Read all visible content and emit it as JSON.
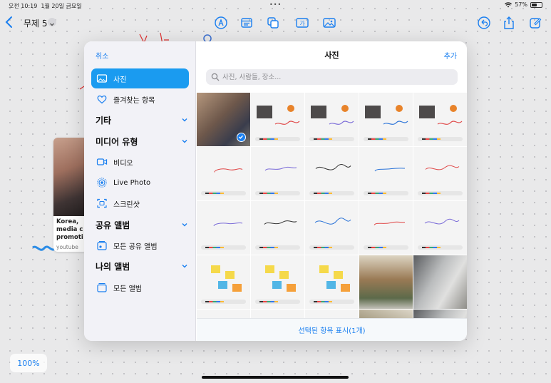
{
  "status": {
    "time": "오전 10:19",
    "date": "1월 20일 금요일",
    "battery": "57%",
    "battery_level": 0.57
  },
  "topbar": {
    "title": "무제 5",
    "tools": [
      "markup-pen-icon",
      "text-box-icon",
      "shapes-icon",
      "text-icon",
      "photo-icon",
      "undo-icon",
      "share-icon",
      "compose-icon"
    ]
  },
  "canvas": {
    "sticker": {
      "caption_lines": [
        "Korea,",
        "media c",
        "promoti"
      ],
      "source": "youtube"
    },
    "zoom": "100%"
  },
  "picker": {
    "cancel": "취소",
    "title": "사진",
    "add": "추가",
    "search_placeholder": "사진, 사람들, 장소...",
    "sidebar": {
      "photos": "사진",
      "favorites": "즐겨찾는 항목",
      "other_header": "기타",
      "media_header": "미디어 유형",
      "videos": "비디오",
      "live_photo": "Live Photo",
      "screenshots": "스크린샷",
      "shared_header": "공유 앨범",
      "all_shared": "모든 공유 앨범",
      "my_albums_header": "나의 앨범",
      "all_albums": "모든 앨범"
    },
    "footer": "선택된 항목 표시(1개)",
    "selected_index": 0
  },
  "colors": {
    "accent": "#1a7ff0",
    "active_row": "#1a9bf0"
  }
}
